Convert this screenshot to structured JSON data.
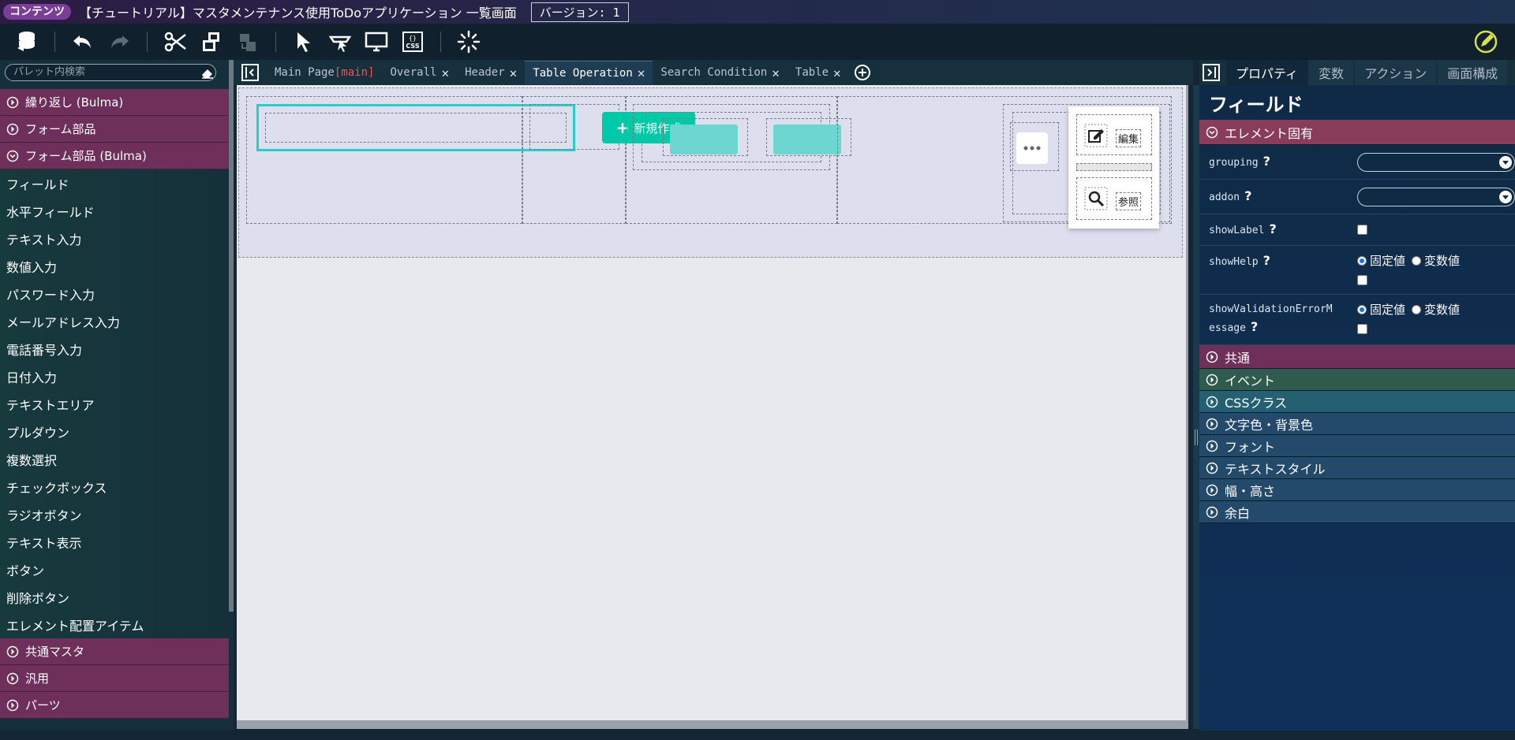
{
  "titlebar": {
    "badge": "コンテンツ",
    "title": "【チュートリアル】マスタメンテナンス使用ToDoアプリケーション 一覧画面",
    "version": "バージョン: 1"
  },
  "toolbar": {
    "icons": [
      "database-icon",
      "undo-icon",
      "redo-icon",
      "cut-icon",
      "copy-icon",
      "paste-icon",
      "select-pointer-icon",
      "select-parent-icon",
      "preview-icon",
      "css-icon",
      "loading-icon",
      "edit-mode-icon"
    ],
    "css_label": "CSS"
  },
  "palette": {
    "search_placeholder": "パレット内検索",
    "categories_top": [
      {
        "label": "繰り返し (Bulma)"
      },
      {
        "label": "フォーム部品"
      },
      {
        "label": "フォーム部品 (Bulma)"
      }
    ],
    "items": [
      "フィールド",
      "水平フィールド",
      "テキスト入力",
      "数値入力",
      "パスワード入力",
      "メールアドレス入力",
      "電話番号入力",
      "日付入力",
      "テキストエリア",
      "プルダウン",
      "複数選択",
      "チェックボックス",
      "ラジオボタン",
      "テキスト表示",
      "ボタン",
      "削除ボタン",
      "エレメント配置アイテム"
    ],
    "categories_bottom": [
      {
        "label": "共通マスタ"
      },
      {
        "label": "汎用"
      },
      {
        "label": "パーツ"
      }
    ]
  },
  "tabs": {
    "items": [
      {
        "label": "Main Page",
        "tag": "[main]",
        "closable": false
      },
      {
        "label": "Overall",
        "closable": true
      },
      {
        "label": "Header",
        "closable": true
      },
      {
        "label": "Table Operation",
        "closable": true,
        "active": true
      },
      {
        "label": "Search Condition",
        "closable": true
      },
      {
        "label": "Table",
        "closable": true
      }
    ],
    "close_glyph": "✕"
  },
  "canvas": {
    "new_button_label": "新規作成",
    "edit_label": "編集",
    "view_label": "参照"
  },
  "right_panel": {
    "tabs": [
      {
        "label": "プロパティ",
        "active": true
      },
      {
        "label": "変数"
      },
      {
        "label": "アクション"
      },
      {
        "label": "画面構成"
      }
    ],
    "title": "フィールド",
    "section_specific": "エレメント固有",
    "props": {
      "grouping": "grouping",
      "addon": "addon",
      "showLabel": "showLabel",
      "showHelp": "showHelp",
      "showValidation_line1": "showValidationErrorM",
      "showValidation_line2": "essage"
    },
    "help_glyph": "?",
    "radio_fixed": "固定値",
    "radio_variable": "変数値",
    "sections": [
      {
        "label": "共通",
        "color": "#6e2f5b"
      },
      {
        "label": "イベント",
        "color": "#2f5a4e"
      },
      {
        "label": "CSSクラス",
        "color": "#246072"
      },
      {
        "label": "文字色・背景色",
        "color": "#244a6b"
      },
      {
        "label": "フォント",
        "color": "#244a6b"
      },
      {
        "label": "テキストスタイル",
        "color": "#244a6b"
      },
      {
        "label": "幅・高さ",
        "color": "#244a6b"
      },
      {
        "label": "余白",
        "color": "#244a6b"
      }
    ],
    "section_specific_color": "#8a3d5a"
  }
}
